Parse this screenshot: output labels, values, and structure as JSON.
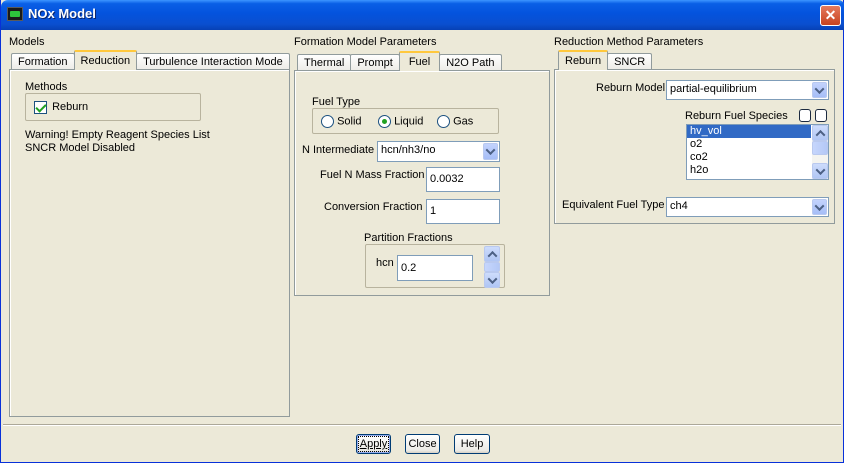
{
  "window": {
    "title": "NOx Model",
    "icon": "fluent-app-icon",
    "close_symbol": "✕"
  },
  "models": {
    "section_label": "Models",
    "tabs": [
      "Formation",
      "Reduction",
      "Turbulence Interaction Mode"
    ],
    "active_tab": "Reduction",
    "methods_label": "Methods",
    "reburn_label": "Reburn",
    "reburn_checked": true,
    "warning_line1": "Warning! Empty Reagent Species List",
    "warning_line2": "SNCR Model Disabled"
  },
  "formation": {
    "section_label": "Formation Model Parameters",
    "tabs": [
      "Thermal",
      "Prompt",
      "Fuel",
      "N2O Path"
    ],
    "active_tab": "Fuel",
    "fuel_type_label": "Fuel Type",
    "fuel_types": [
      "Solid",
      "Liquid",
      "Gas"
    ],
    "selected_fuel_type": "Liquid",
    "n_intermediate_label": "N Intermediate",
    "n_intermediate_value": "hcn/nh3/no",
    "fuel_n_mass_fraction_label": "Fuel N Mass Fraction",
    "fuel_n_mass_fraction_value": "0.0032",
    "conversion_fraction_label": "Conversion Fraction",
    "conversion_fraction_value": "1",
    "partition_fractions_label": "Partition Fractions",
    "partition_species_label": "hcn",
    "partition_value": "0.2"
  },
  "reduction": {
    "section_label": "Reduction Method Parameters",
    "tabs": [
      "Reburn",
      "SNCR"
    ],
    "active_tab": "Reburn",
    "reburn_model_label": "Reburn Model",
    "reburn_model_value": "partial-equilibrium",
    "reburn_fuel_species_label": "Reburn Fuel Species",
    "species": [
      "hv_vol",
      "o2",
      "co2",
      "h2o"
    ],
    "selected_species": "hv_vol",
    "equivalent_fuel_type_label": "Equivalent Fuel Type",
    "equivalent_fuel_type_value": "ch4"
  },
  "buttons": {
    "apply": "Apply",
    "close": "Close",
    "help": "Help"
  },
  "colors": {
    "titlebar": "#0453dd",
    "window_bg": "#ece9d8",
    "selection": "#316ac5",
    "close_button": "#c8431f"
  }
}
